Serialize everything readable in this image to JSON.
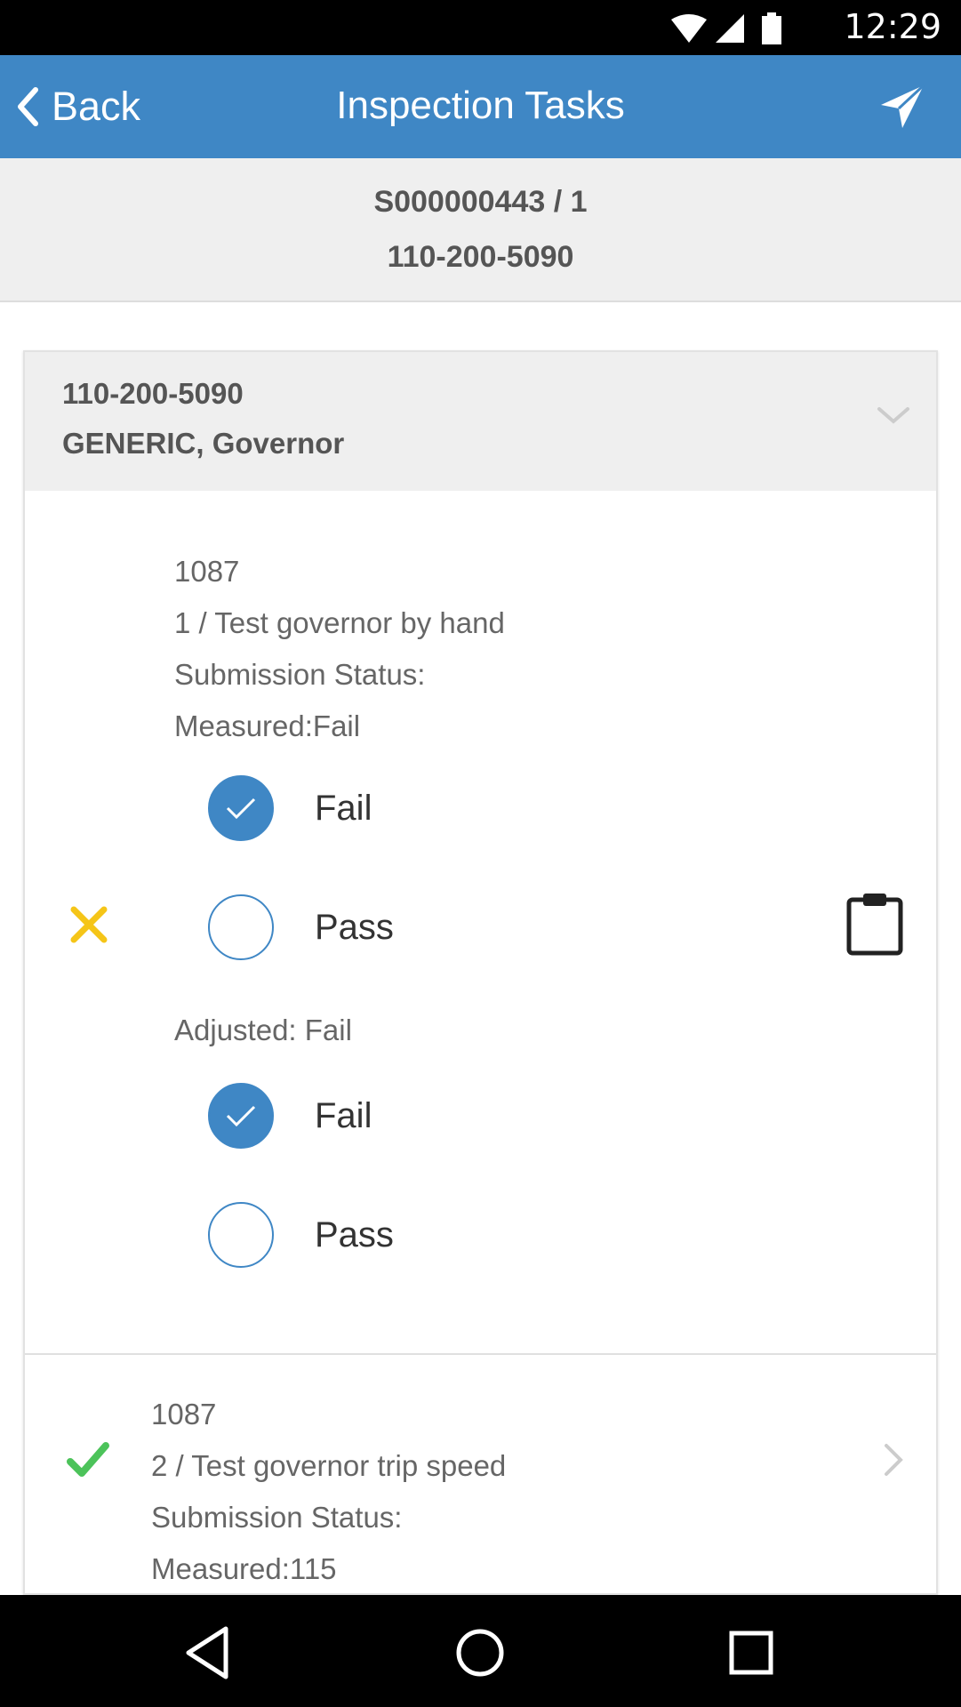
{
  "status_bar": {
    "time": "12:29"
  },
  "app_bar": {
    "back_label": "Back",
    "title": "Inspection Tasks",
    "send_icon": "send-icon"
  },
  "sub_header": {
    "line1": "S000000443 / 1",
    "line2": "110-200-5090"
  },
  "card": {
    "header_line1": "110-200-5090",
    "header_line2": "GENERIC, Governor",
    "task1": {
      "id": "1087",
      "name": "1 / Test governor by hand",
      "submission_status": "Submission Status:",
      "measured": "Measured:Fail",
      "measured_options": [
        {
          "label": "Fail",
          "checked": true
        },
        {
          "label": "Pass",
          "checked": false
        }
      ],
      "adjusted": "Adjusted: Fail",
      "adjusted_options": [
        {
          "label": "Fail",
          "checked": true
        },
        {
          "label": "Pass",
          "checked": false
        }
      ],
      "status_icon": "x-mark-icon",
      "status_color": "#f5c518"
    },
    "task2": {
      "id": "1087",
      "name": "2 / Test governor trip speed",
      "submission_status": "Submission Status:",
      "measured": "Measured:115",
      "status_icon": "checkmark-icon",
      "status_color": "#4cc35a"
    }
  },
  "colors": {
    "primary": "#3f87c5",
    "header_bg": "#efefef"
  }
}
